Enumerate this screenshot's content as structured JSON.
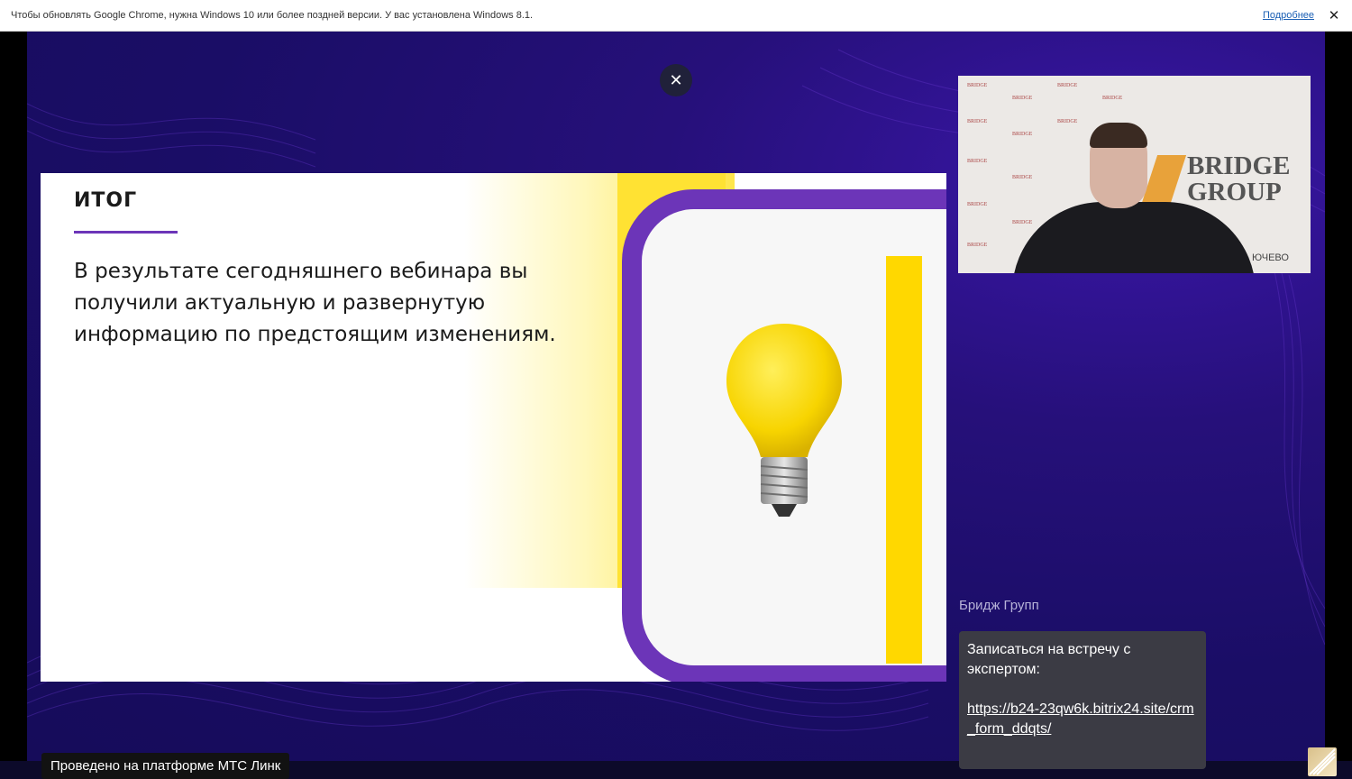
{
  "infobar": {
    "message": "Чтобы обновлять Google Chrome, нужна Windows 10 или более поздней версии. У вас установлена Windows 8.1.",
    "link_label": "Подробнее",
    "close_glyph": "✕"
  },
  "player": {
    "close_glyph": "✕",
    "platform_label": "Проведено на платформе МТС Линк"
  },
  "slide": {
    "title": "ИТОГ",
    "body": "В результате сегодняшнего вебинара вы получили актуальную и развернутую информацию по предстоящим изменениям.",
    "accent_color": "#6c35b8",
    "highlight_color": "#ffd800"
  },
  "camera": {
    "brand_line1": "BRIDGE",
    "brand_line2": "GROUP",
    "tile_text": "BRIDGE",
    "banner_text": "ЮЧЕВО"
  },
  "chat": {
    "sender": "Бридж Групп",
    "message": "Записаться на встречу с экспертом:",
    "link": "https://b24-23qw6k.bitrix24.site/crm_form_ddqts/"
  }
}
